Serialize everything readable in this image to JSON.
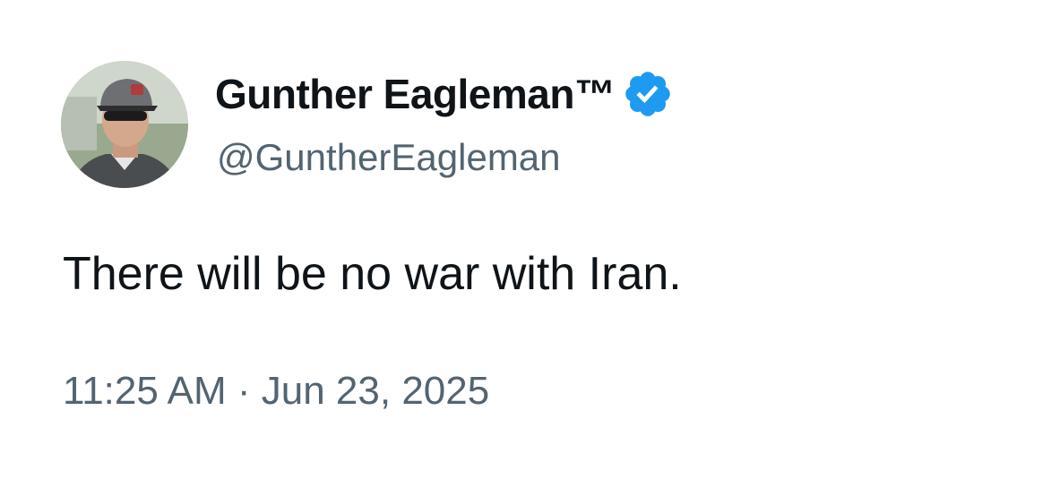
{
  "tweet": {
    "author": {
      "display_name": "Gunther Eagleman™",
      "handle": "@GuntherEagleman",
      "verified": true,
      "verified_icon": "verified-badge-icon",
      "verified_color": "#1d9bf0"
    },
    "text": "There will be no war with Iran.",
    "time": "11:25 AM",
    "separator": "·",
    "date": "Jun 23, 2025"
  },
  "colors": {
    "primary_text": "#0f1419",
    "secondary_text": "#536471",
    "background": "#ffffff"
  }
}
